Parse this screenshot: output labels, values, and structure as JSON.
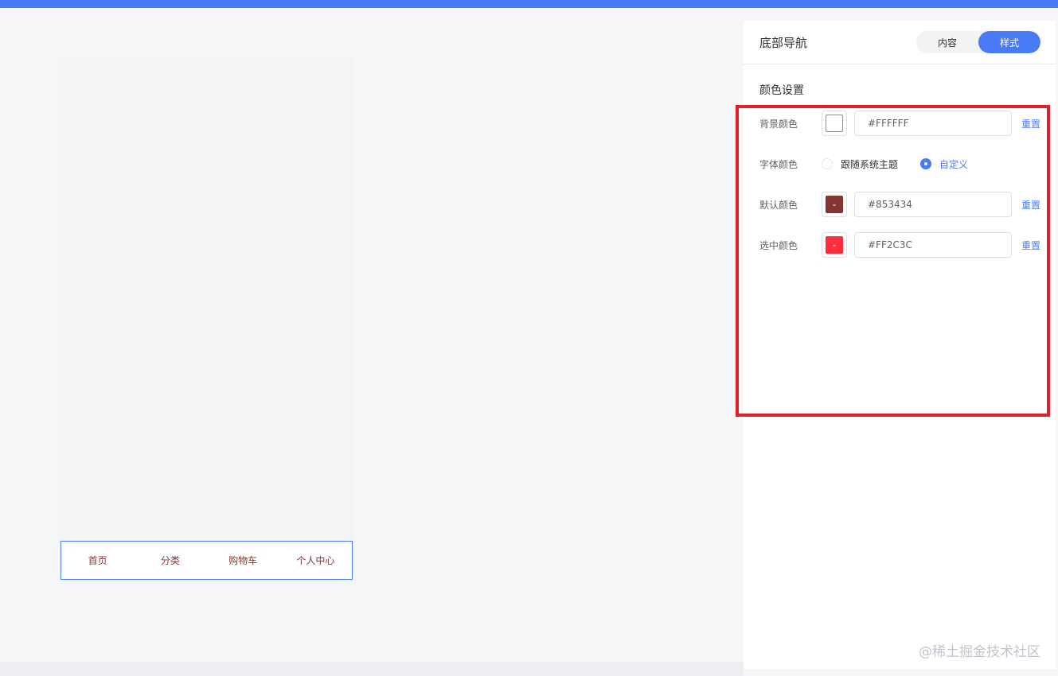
{
  "colors": {
    "accent": "#4A7BF7",
    "highlight_box": "#E0202E"
  },
  "preview": {
    "tabbar": {
      "items": [
        "首页",
        "分类",
        "购物车",
        "个人中心"
      ]
    }
  },
  "panel": {
    "title": "底部导航",
    "tabs": [
      {
        "label": "内容",
        "active": false
      },
      {
        "label": "样式",
        "active": true
      }
    ],
    "section_title": "颜色设置",
    "background_color": {
      "label": "背景颜色",
      "value": "#FFFFFF",
      "swatch": "#FFFFFF",
      "reset_label": "重置"
    },
    "font_color": {
      "label": "字体颜色",
      "options": [
        {
          "label": "跟随系统主题",
          "checked": false
        },
        {
          "label": "自定义",
          "checked": true
        }
      ]
    },
    "default_color": {
      "label": "默认颜色",
      "value": "#853434",
      "swatch": "#853434",
      "reset_label": "重置"
    },
    "selected_color": {
      "label": "选中颜色",
      "value": "#FF2C3C",
      "swatch": "#FF2C3C",
      "reset_label": "重置"
    }
  },
  "watermark": "@稀土掘金技术社区"
}
